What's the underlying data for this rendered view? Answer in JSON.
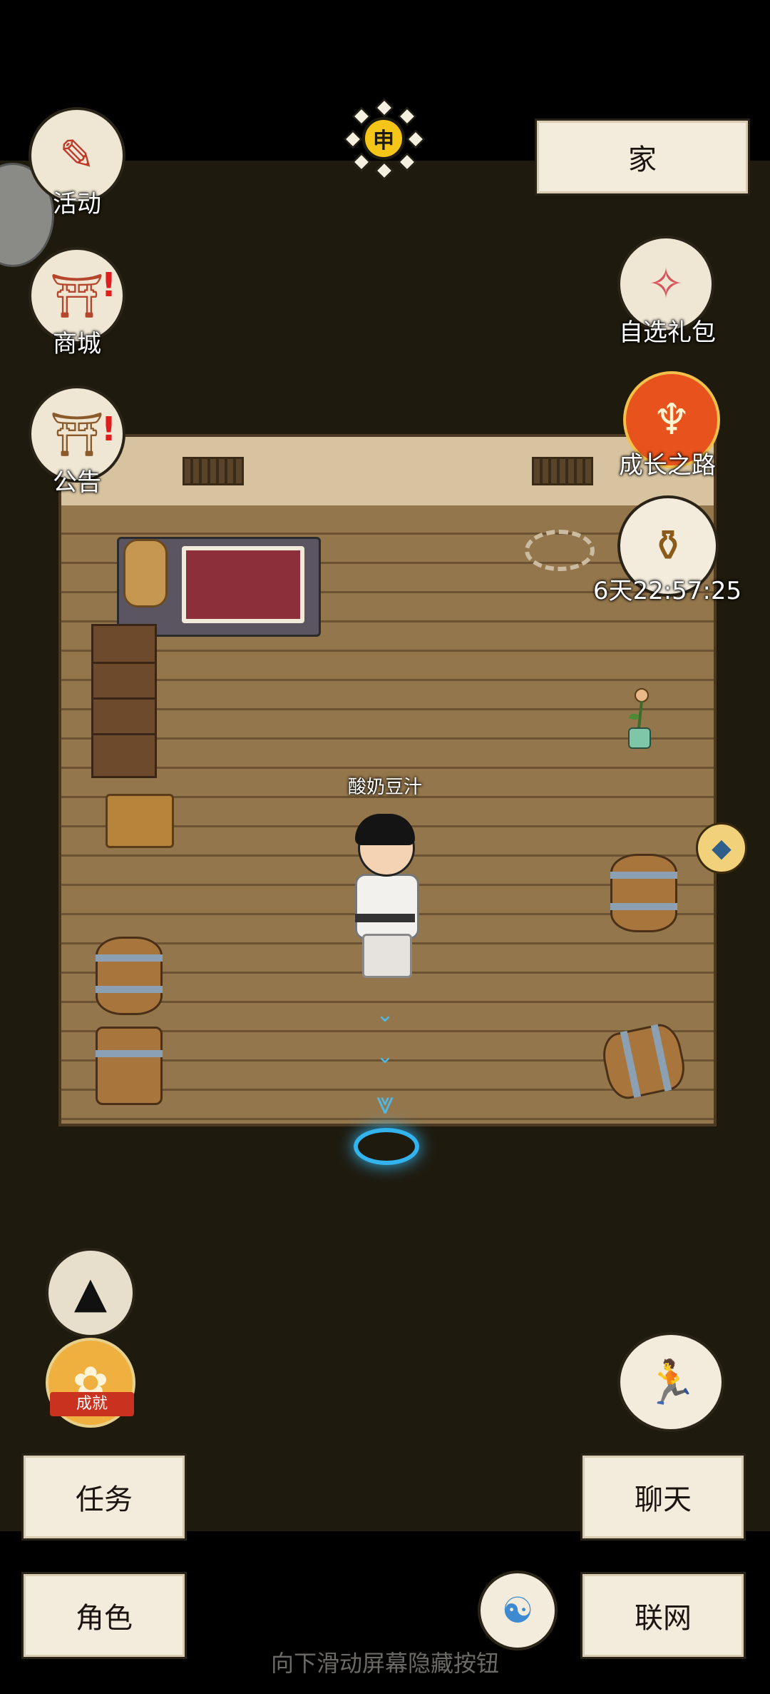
{
  "header": {
    "time_icon_char": "申",
    "location_label": "家"
  },
  "left_menu": {
    "activity_label": "活动",
    "shop_label": "商城",
    "notice_label": "公告"
  },
  "right_menu": {
    "gift_pack_label": "自选礼包",
    "growth_path_label": "成长之路",
    "event_timer": "6天22:57:25"
  },
  "player": {
    "name": "酸奶豆汁"
  },
  "achievement": {
    "ribbon_label": "成就"
  },
  "bottom_buttons": {
    "task_label": "任务",
    "chat_label": "聊天",
    "character_label": "角色",
    "network_label": "联网"
  },
  "system_hint": "向下滑动屏幕隐藏按钮",
  "colors": {
    "accent_gold": "#f5c518",
    "portal_blue": "#33b4ee",
    "alert_red": "#e01c1c",
    "paper": "#f3ebdc"
  },
  "icons": {
    "activity": "scroll-fan-icon",
    "shop": "market-stall-icon",
    "notice": "notice-board-icon",
    "gift": "gift-bag-icon",
    "growth": "growth-figure-icon",
    "event": "bronze-vessel-icon",
    "hat": "straw-hat-icon",
    "run": "running-figure-icon",
    "meditate": "meditation-icon",
    "side_gem": "crystal-gem-icon"
  }
}
